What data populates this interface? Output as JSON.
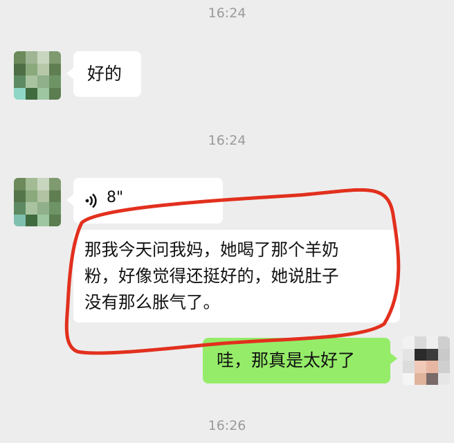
{
  "timestamps": [
    "16:24",
    "16:24",
    "16:26"
  ],
  "messages": {
    "m1": {
      "text": "好的"
    },
    "voice": {
      "duration": "8\""
    },
    "transcript": {
      "lines": [
        "那我今天问我妈，她喝了那个羊奶",
        "粉，好像觉得还挺好的，她说肚子",
        "没有那么胀气了。"
      ]
    },
    "reply": {
      "text": "哇，那真是太好了"
    }
  },
  "icons": {
    "voice": "voice-wave-icon"
  },
  "colors": {
    "background": "#ededed",
    "bubble_incoming": "#ffffff",
    "bubble_outgoing": "#95ec69",
    "timestamp": "#9a9a9a",
    "annotation": "#e2301e"
  }
}
